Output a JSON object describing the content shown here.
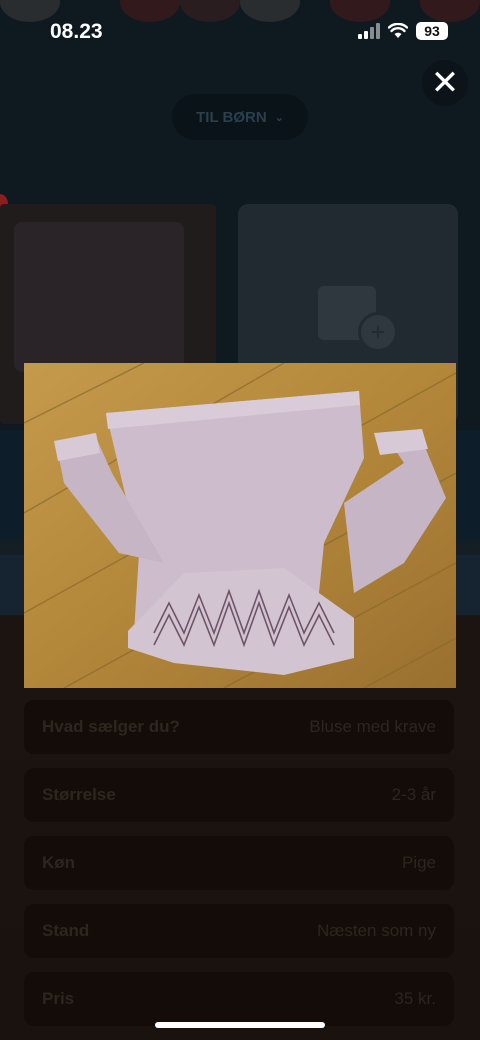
{
  "status_bar": {
    "time": "08.23",
    "battery": "93"
  },
  "header": {
    "category_button": "TIL BØRN",
    "close_label": "✕"
  },
  "form_rows": [
    {
      "label": "Hvad sælger du?",
      "value": "Bluse med krave"
    },
    {
      "label": "Størrelse",
      "value": "2-3 år"
    },
    {
      "label": "Køn",
      "value": "Pige"
    },
    {
      "label": "Stand",
      "value": "Næsten som ny"
    },
    {
      "label": "Pris",
      "value": "35 kr."
    }
  ],
  "colors": {
    "photo_floor": "#b8893a",
    "garment": "#c9b9c9",
    "overlay_bg": "#1a1410"
  }
}
